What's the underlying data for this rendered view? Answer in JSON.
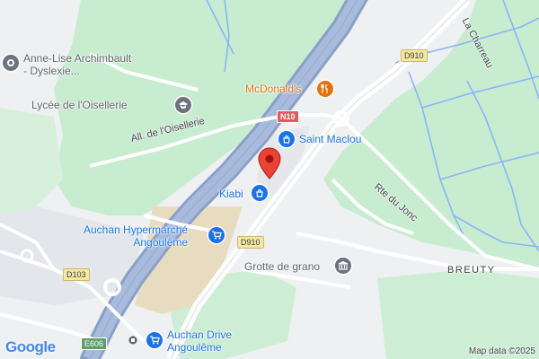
{
  "map": {
    "poi": {
      "anne_lise_line1": "Anne-Lise Archimbault",
      "anne_lise_line2": "- Dyslexie...",
      "lycee": "Lycée de l'Oisellerie",
      "mcdonalds": "McDonald's",
      "saint_maclou": "Saint Maclou",
      "kiabi": "Kiabi",
      "auchan_hyper_line1": "Auchan Hypermarché",
      "auchan_hyper_line2": "Angoulême",
      "grotte": "Grotte de grano",
      "auchan_drive_line1": "Auchan Drive",
      "auchan_drive_line2": "Angoulême"
    },
    "streets": {
      "oisellerie": "All. de l'Oisellerie",
      "rte_jonc": "Rte du Jonc",
      "charreau": "La Charreau"
    },
    "towns": {
      "breuty": "BREUTY"
    },
    "road_shields": {
      "n10": "N10",
      "d910_top": "D910",
      "d910_mid": "D910",
      "d103": "D103",
      "e606": "E606"
    },
    "brand": {
      "google": "Google"
    },
    "attribution": "Map data ©2025",
    "colors": {
      "park": "#c8ecd0",
      "water": "#8ab4f8",
      "highway": "#8aa0c8",
      "commercial": "#e8dcc0",
      "pin": "#ea4335"
    }
  }
}
